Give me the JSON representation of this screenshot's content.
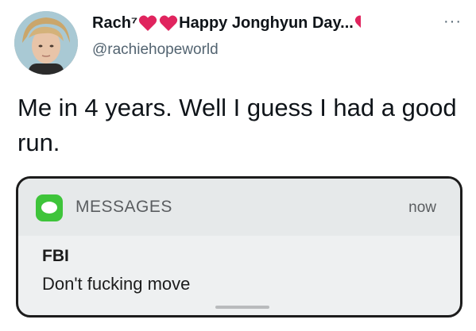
{
  "author": {
    "display_name_prefix": "Rach⁷",
    "display_name_suffix": "Happy Jonghyun Day...",
    "handle": "@rachiehopeworld",
    "heart_color": "#e0245e"
  },
  "tweet": {
    "text": "Me in 4 years. Well I guess I had a good run."
  },
  "more_menu": {
    "label": "···"
  },
  "notification": {
    "app_name": "MESSAGES",
    "time": "now",
    "sender": "FBI",
    "message": "Don't fucking move",
    "app_icon_color": "#3ec43a"
  }
}
